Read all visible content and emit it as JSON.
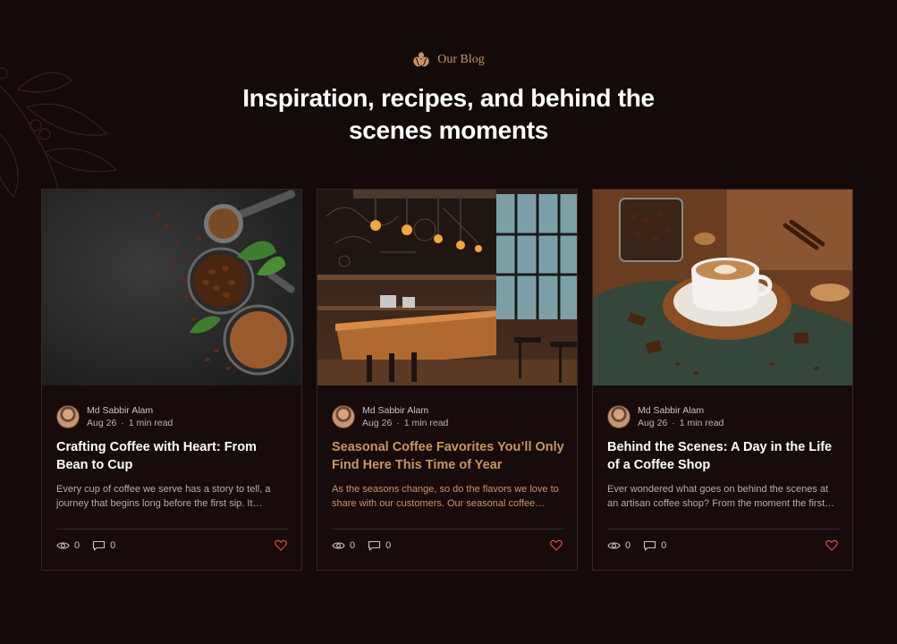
{
  "section": {
    "eyebrow": "Our Blog",
    "title_line1": "Inspiration, recipes, and behind the",
    "title_line2": "scenes moments"
  },
  "colors": {
    "background": "#150a0a",
    "accent": "#c99466",
    "heart": "#e0483d"
  },
  "posts": [
    {
      "author": "Md Sabbir Alam",
      "date": "Aug 26",
      "read_time": "1 min read",
      "title": "Crafting Coffee with Heart: From Bean to Cup",
      "excerpt": "Every cup of coffee we serve has a story to tell, a journey that begins long before the first sip. It…",
      "views": "0",
      "comments": "0",
      "image": "coffee-beans-and-grounds"
    },
    {
      "author": "Md Sabbir Alam",
      "date": "Aug 26",
      "read_time": "1 min read",
      "title": "Seasonal Coffee Favorites You’ll Only Find Here This Time of Year",
      "excerpt": "As the seasons change, so do the flavors we love to share with our customers. Our seasonal coffee…",
      "views": "0",
      "comments": "0",
      "image": "coffee-shop-interior"
    },
    {
      "author": "Md Sabbir Alam",
      "date": "Aug 26",
      "read_time": "1 min read",
      "title": "Behind the Scenes: A Day in the Life of a Coffee Shop",
      "excerpt": "Ever wondered what goes on behind the scenes at an artisan coffee shop? From the moment the first…",
      "views": "0",
      "comments": "0",
      "image": "latte-art-cup"
    }
  ]
}
